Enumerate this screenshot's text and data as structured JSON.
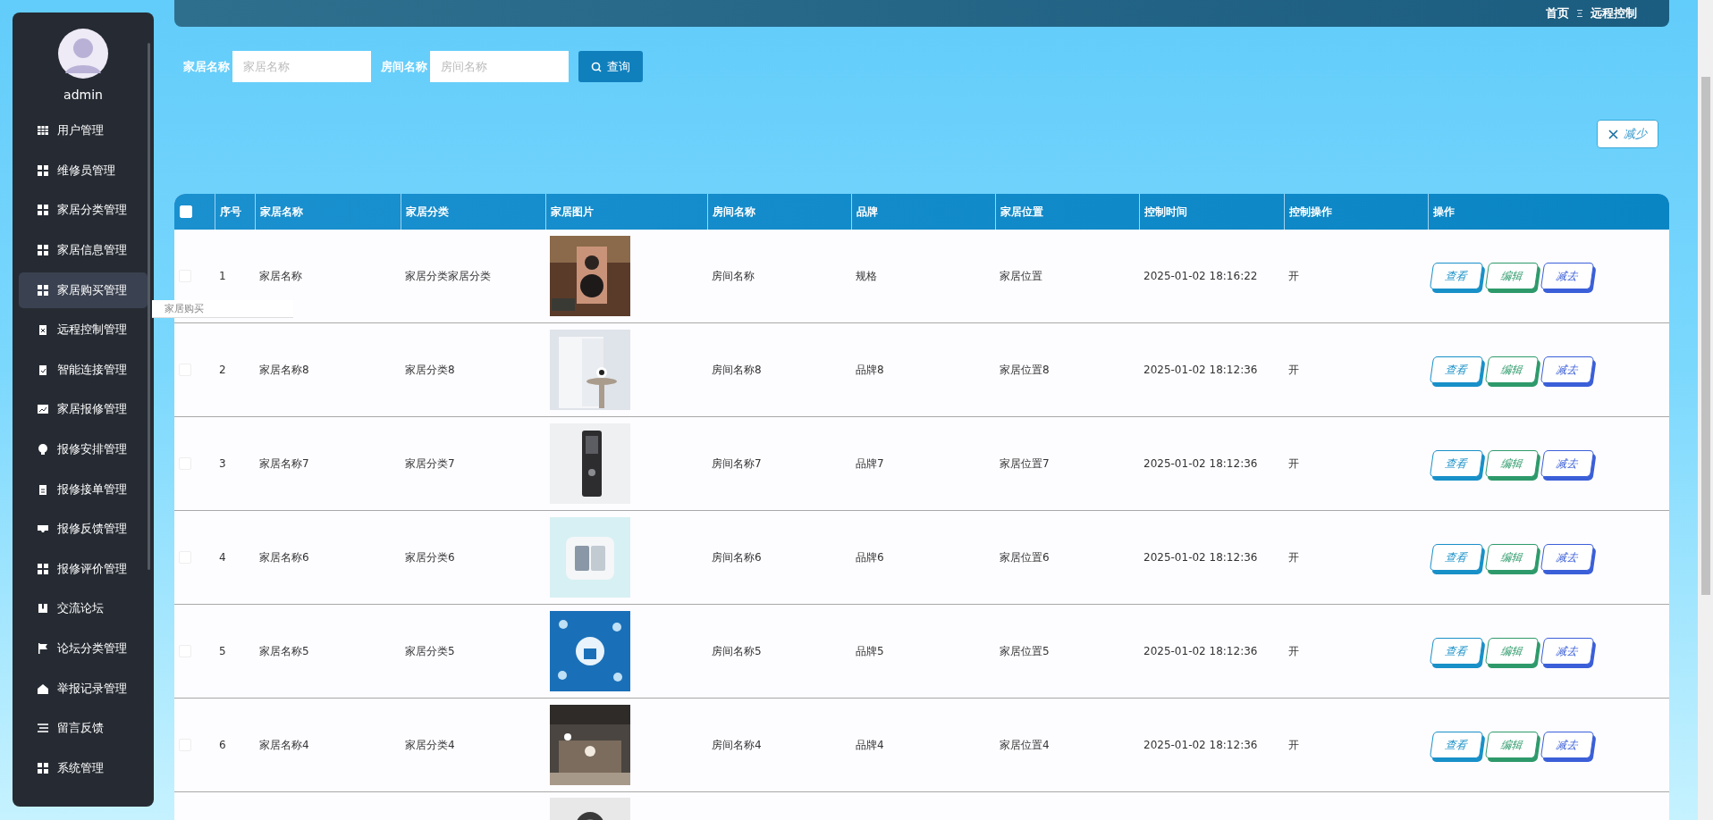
{
  "sidebar": {
    "username": "admin",
    "items": [
      {
        "label": "用户管理",
        "selected": false
      },
      {
        "label": "维修员管理",
        "selected": false
      },
      {
        "label": "家居分类管理",
        "selected": false
      },
      {
        "label": "家居信息管理",
        "selected": false
      },
      {
        "label": "家居购买管理",
        "selected": true
      },
      {
        "label": "远程控制管理",
        "selected": false
      },
      {
        "label": "智能连接管理",
        "selected": false
      },
      {
        "label": "家居报修管理",
        "selected": false
      },
      {
        "label": "报修安排管理",
        "selected": false
      },
      {
        "label": "报修接单管理",
        "selected": false
      },
      {
        "label": "报修反馈管理",
        "selected": false
      },
      {
        "label": "报修评价管理",
        "selected": false
      },
      {
        "label": "交流论坛",
        "selected": false
      },
      {
        "label": "论坛分类管理",
        "selected": false
      },
      {
        "label": "举报记录管理",
        "selected": false
      },
      {
        "label": "留言反馈",
        "selected": false
      },
      {
        "label": "系统管理",
        "selected": false
      }
    ],
    "tooltip": "家居购买"
  },
  "breadcrumb": [
    "首页",
    "远程控制"
  ],
  "search": {
    "fields": [
      {
        "label": "家居名称",
        "placeholder": "家居名称"
      },
      {
        "label": "房间名称",
        "placeholder": "房间名称"
      }
    ],
    "button": "查询"
  },
  "reduce_button": "减少",
  "table": {
    "header_checked": false,
    "columns": [
      "序号",
      "家居名称",
      "家居分类",
      "家居图片",
      "房间名称",
      "品牌",
      "家居位置",
      "控制时间",
      "控制操作",
      "操作"
    ],
    "rows": [
      {
        "checked": false,
        "no": "1",
        "name": "家居名称",
        "category": "家居分类家居分类",
        "room": "房间名称",
        "brand": "规格",
        "location": "家居位置",
        "time": "2025-01-02 18:16:22",
        "control": "开",
        "actions": [
          "查看",
          "编辑",
          "减去"
        ]
      },
      {
        "checked": false,
        "no": "2",
        "name": "家居名称8",
        "category": "家居分类8",
        "room": "房间名称8",
        "brand": "品牌8",
        "location": "家居位置8",
        "time": "2025-01-02 18:12:36",
        "control": "开",
        "actions": [
          "查看",
          "编辑",
          "减去"
        ]
      },
      {
        "checked": false,
        "no": "3",
        "name": "家居名称7",
        "category": "家居分类7",
        "room": "房间名称7",
        "brand": "品牌7",
        "location": "家居位置7",
        "time": "2025-01-02 18:12:36",
        "control": "开",
        "actions": [
          "查看",
          "编辑",
          "减去"
        ]
      },
      {
        "checked": false,
        "no": "4",
        "name": "家居名称6",
        "category": "家居分类6",
        "room": "房间名称6",
        "brand": "品牌6",
        "location": "家居位置6",
        "time": "2025-01-02 18:12:36",
        "control": "开",
        "actions": [
          "查看",
          "编辑",
          "减去"
        ]
      },
      {
        "checked": false,
        "no": "5",
        "name": "家居名称5",
        "category": "家居分类5",
        "room": "房间名称5",
        "brand": "品牌5",
        "location": "家居位置5",
        "time": "2025-01-02 18:12:36",
        "control": "开",
        "actions": [
          "查看",
          "编辑",
          "减去"
        ]
      },
      {
        "checked": false,
        "no": "6",
        "name": "家居名称4",
        "category": "家居分类4",
        "room": "房间名称4",
        "brand": "品牌4",
        "location": "家居位置4",
        "time": "2025-01-02 18:12:36",
        "control": "开",
        "actions": [
          "查看",
          "编辑",
          "减去"
        ]
      }
    ]
  }
}
